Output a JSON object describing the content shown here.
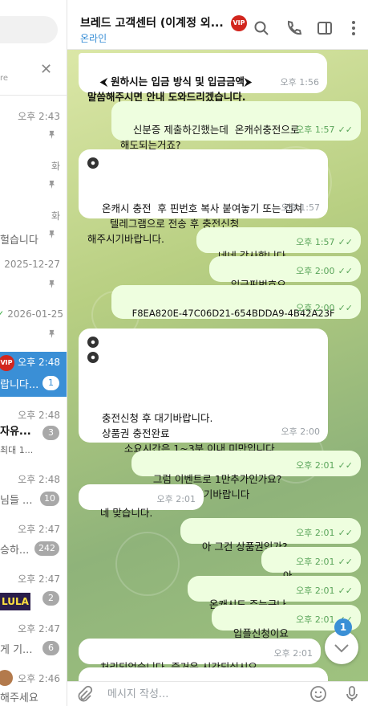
{
  "sidebar": {
    "search_hint": "re",
    "chats": [
      {
        "time": "오후 2:43",
        "preview": "",
        "pinned": true
      },
      {
        "time": "화",
        "preview": "",
        "pinned": true
      },
      {
        "time": "화",
        "preview": "헐습니다",
        "pinned": true
      },
      {
        "time": "2025-12-27",
        "preview": "",
        "pinned": true
      },
      {
        "time": "2026-01-25",
        "preview": "",
        "pinned": true
      },
      {
        "time": "오후 2:48",
        "preview": "랍니다...",
        "badge": "1",
        "active": true
      },
      {
        "time": "오후 2:48",
        "preview": "자유...",
        "sub": "최대 1...",
        "badge": "3"
      },
      {
        "time": "오후 2:48",
        "preview": "님들 ...",
        "badge": "10"
      },
      {
        "time": "오후 2:47",
        "preview": "승하...",
        "badge": "242"
      },
      {
        "time": "오후 2:47",
        "preview": "LULA",
        "badge": "2"
      },
      {
        "time": "오후 2:47",
        "preview": "게 기...",
        "badge": "6"
      },
      {
        "time": "오후 2:46",
        "preview": "해주세요"
      }
    ]
  },
  "header": {
    "title": "브레드 고객센터 (이계정 외...",
    "vip_label": "VIP",
    "status": "온라인"
  },
  "messages": [
    {
      "dir": "in",
      "text": "⮜ 원하시는 입금 방식 및 입금금액⮞\n말씀해주시면 안내 도와드리겠습니다.",
      "time": "오후 1:56"
    },
    {
      "dir": "out",
      "text": "신분증 제출하긴했는데  온캐쉬충전으로\n해도되는거죠?",
      "time": "오후 1:57"
    },
    {
      "dir": "in",
      "text": "온캐시 충전  후 핀번호 복사 붙여놓기 또는 캡쳐\n       텔레그램으로 전송 후 충전신청\n해주시기바랍니다.",
      "time": "오후 1:57"
    },
    {
      "dir": "out",
      "text": "네네 감사합니다",
      "time": "오후 1:57"
    },
    {
      "dir": "out",
      "text": "입금핀번호요",
      "time": "오후 2:00"
    },
    {
      "dir": "out",
      "text": "F8EA820E-47C06D21-654BDDA9-4B42A23F",
      "time": "오후 2:00"
    },
    {
      "dir": "in",
      "text": "충전신청 후 대기바랍니다.\n상품권 충전완료\n       소요시간은 1~3분 이내 미만입니다.\n\n\n오늘도 즐거운 하루 되시기바랍니다",
      "time": "오후 2:00"
    },
    {
      "dir": "out",
      "text": "그럼 이벤트로 1만추가인가요?",
      "time": "오후 2:01"
    },
    {
      "dir": "in",
      "text": "네 맞습니다.",
      "time": "오후 2:01"
    },
    {
      "dir": "out",
      "text": "아 그건 상품권인가?",
      "time": "오후 2:01"
    },
    {
      "dir": "out",
      "text": "아",
      "time": "오후 2:01"
    },
    {
      "dir": "out",
      "text": "온캐시도 주는구나",
      "time": "오후 2:01"
    },
    {
      "dir": "out",
      "text": "입플신청이요",
      "time": "오후 2:01"
    },
    {
      "dir": "in",
      "text": "처리되었습니다. 즐거운 시간되십시요",
      "time": "오후 2:01"
    }
  ],
  "scroll_badge": "1",
  "composer": {
    "placeholder": "메시지 작성..."
  },
  "icons": {
    "search": "search-icon",
    "call": "phone-icon",
    "sidebar": "sidebar-toggle-icon",
    "more": "more-vertical-icon",
    "attach": "paperclip-icon",
    "emoji": "emoji-icon",
    "mic": "microphone-icon",
    "scroll": "chevron-down-icon"
  },
  "colors": {
    "accent": "#3a8fd6",
    "outgoing": "#eefedf",
    "incoming": "#ffffff",
    "vip": "#d2261e"
  }
}
